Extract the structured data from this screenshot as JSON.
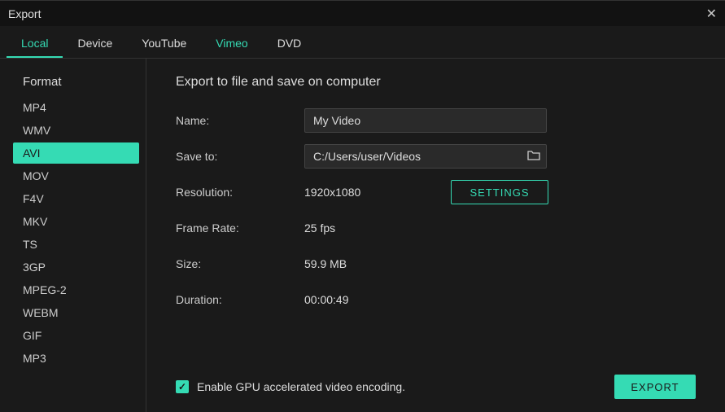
{
  "window": {
    "title": "Export"
  },
  "tabs": {
    "local": "Local",
    "device": "Device",
    "youtube": "YouTube",
    "vimeo": "Vimeo",
    "dvd": "DVD"
  },
  "sidebar": {
    "title": "Format",
    "items": [
      "MP4",
      "WMV",
      "AVI",
      "MOV",
      "F4V",
      "MKV",
      "TS",
      "3GP",
      "MPEG-2",
      "WEBM",
      "GIF",
      "MP3"
    ],
    "selected": "AVI"
  },
  "main": {
    "title": "Export to file and save on computer",
    "labels": {
      "name": "Name:",
      "saveto": "Save to:",
      "resolution": "Resolution:",
      "framerate": "Frame Rate:",
      "size": "Size:",
      "duration": "Duration:"
    },
    "values": {
      "name": "My Video",
      "saveto": "C:/Users/user/Videos",
      "resolution": "1920x1080",
      "framerate": "25 fps",
      "size": "59.9 MB",
      "duration": "00:00:49"
    },
    "settings_btn": "SETTINGS"
  },
  "footer": {
    "gpu_checkbox": "Enable GPU accelerated video encoding.",
    "gpu_checked": true,
    "export_btn": "EXPORT"
  }
}
